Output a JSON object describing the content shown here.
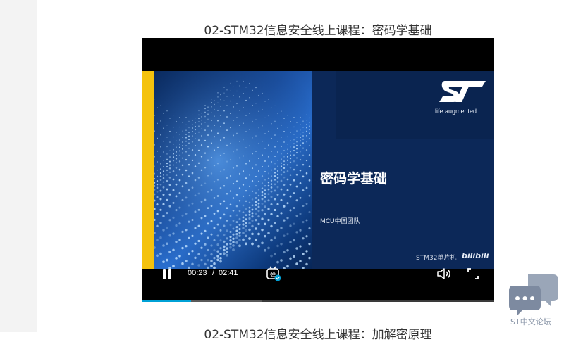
{
  "video_title": "02-STM32信息安全线上课程：密码学基础",
  "next_title": "02-STM32信息安全线上课程：加解密原理",
  "slide": {
    "logo_text": "ST",
    "tagline": "life.augmented",
    "title": "密码学基础",
    "team": "MCU中国团队",
    "watermark": "STM32单片机",
    "bili_mark": "bilibili"
  },
  "player": {
    "current_time": "00:23",
    "separator": "/",
    "duration": "02:41",
    "progress_fraction": 0.14,
    "buffer_fraction": 0.34,
    "accent_color": "#00a1d6"
  },
  "floating_widget": {
    "label": "ST中文论坛",
    "icon": "chat-bubbles-icon"
  },
  "colors": {
    "slide_yellow": "#f4c20d",
    "slide_navy": "#0c2858"
  }
}
